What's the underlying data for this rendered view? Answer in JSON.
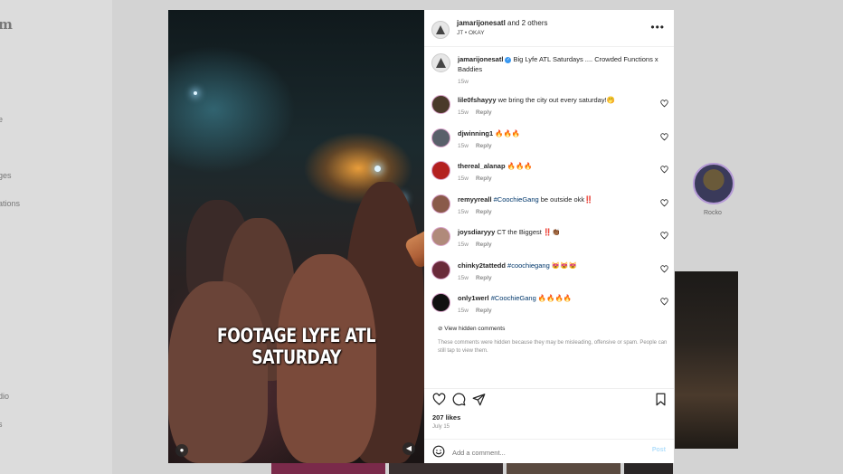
{
  "background": {
    "logo_fragment": "m",
    "nav_fragments": [
      "e",
      "ges",
      "ations",
      "dio",
      "s"
    ],
    "story_name": "Rocko"
  },
  "media": {
    "caption_text": "FOOTAGE LYFE ATL SATURDAY"
  },
  "header": {
    "author": "jamarijonesatl",
    "coauthors": " and 2 others",
    "audio": "JT • OKAY"
  },
  "caption": {
    "user": "jamarijonesatl",
    "text": "Big Lyfe ATL Saturdays .... Crowded Functions x Baddies",
    "time": "15w"
  },
  "comments": [
    {
      "user": "lile0fshayyy",
      "text": " we bring the city out every saturday!🤭",
      "time": "15w",
      "reply": "Reply",
      "avatar_color": "#4a3a2a"
    },
    {
      "user": "djwinning1",
      "text": " 🔥🔥🔥",
      "time": "15w",
      "reply": "Reply",
      "avatar_color": "#59606a"
    },
    {
      "user": "thereal_alanap",
      "text": " 🔥🔥🔥",
      "time": "15w",
      "reply": "Reply",
      "avatar_color": "#b32020"
    },
    {
      "user": "remyyreall",
      "tag": "#CoochieGang",
      "text": " be outside okk‼️",
      "time": "15w",
      "reply": "Reply",
      "avatar_color": "#8a5a4a"
    },
    {
      "user": "joysdiaryyy",
      "text": " CT the Biggest ‼️👏🏾",
      "time": "15w",
      "reply": "Reply",
      "avatar_color": "#b08a7a"
    },
    {
      "user": "chinky2tattedd",
      "tag": "#coochiegang",
      "text": " 😻😻😻",
      "time": "15w",
      "reply": "Reply",
      "avatar_color": "#6a2a3a"
    },
    {
      "user": "only1werl",
      "tag": "#CoochieGang",
      "text": " 🔥🔥🔥🔥",
      "time": "15w",
      "reply": "Reply",
      "avatar_color": "#111111"
    }
  ],
  "hidden": {
    "link": "View hidden comments",
    "note": "These comments were hidden because they may be misleading, offensive or spam. People can still tap to view them."
  },
  "likes": "207 likes",
  "date": "July 15",
  "add_comment": {
    "placeholder": "Add a comment...",
    "post_label": "Post"
  },
  "colors": {
    "link": "#00376b",
    "verified": "#3897f0",
    "post_disabled": "#b2dffc"
  }
}
